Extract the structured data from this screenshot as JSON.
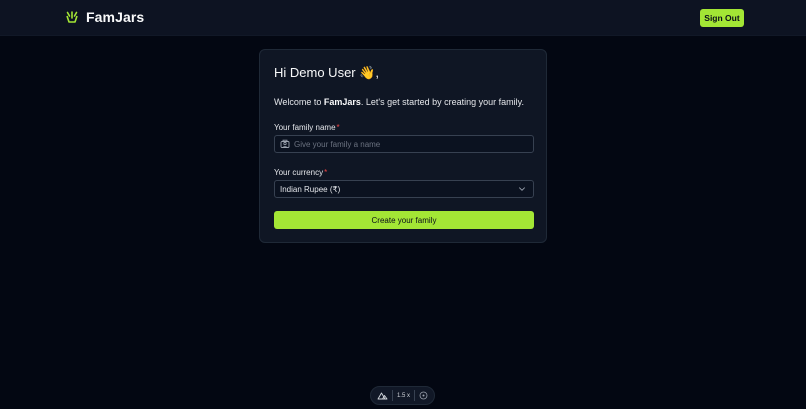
{
  "header": {
    "brand_name": "FamJars",
    "brand_icon": "famjars-logo-icon",
    "sign_out_label": "Sign Out"
  },
  "card": {
    "greeting": "Hi Demo User 👋,",
    "welcome_prefix": "Welcome to ",
    "welcome_brand": "FamJars",
    "welcome_suffix": ". Let's get started by creating your family.",
    "family_name": {
      "label": "Your family name",
      "required_mark": "*",
      "placeholder": "Give your family a name",
      "value": "",
      "icon": "family-icon"
    },
    "currency": {
      "label": "Your currency",
      "required_mark": "*",
      "selected": "Indian Rupee (₹)",
      "icon": "chevron-down-icon"
    },
    "create_button_label": "Create your family"
  },
  "devbar": {
    "zoom_label": "1.5 x"
  },
  "colors": {
    "accent": "#a3e635",
    "background": "#030712",
    "header": "#0d1322",
    "card": "#0f1624",
    "required": "#ef4444"
  }
}
